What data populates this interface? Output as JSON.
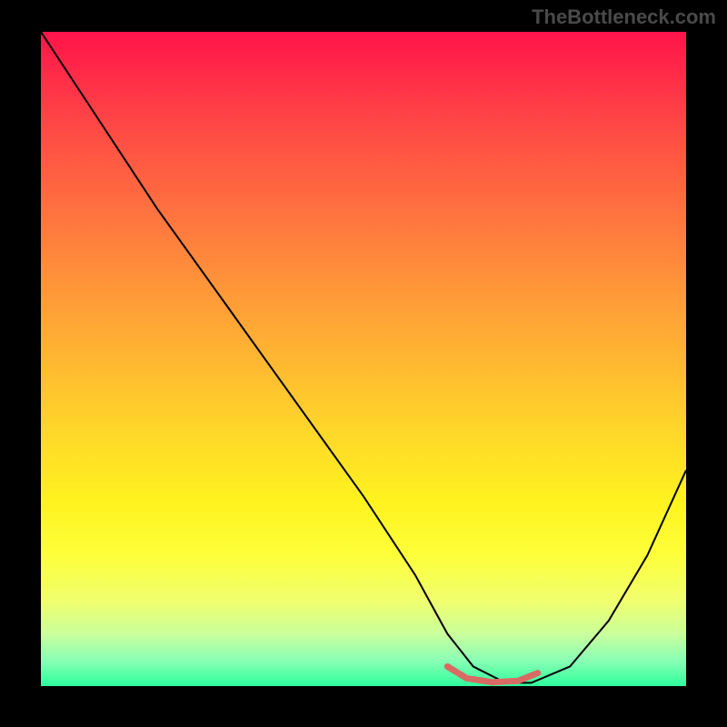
{
  "watermark": "TheBottleneck.com",
  "chart_data": {
    "type": "line",
    "title": "",
    "xlabel": "",
    "ylabel": "",
    "xlim": [
      0,
      100
    ],
    "ylim": [
      0,
      100
    ],
    "series": [
      {
        "name": "curve",
        "x": [
          0,
          4,
          10,
          18,
          26,
          34,
          42,
          50,
          58,
          63,
          67,
          72,
          76,
          82,
          88,
          94,
          100
        ],
        "values": [
          100,
          94,
          85,
          73,
          62,
          51,
          40,
          29,
          17,
          8,
          3,
          0.5,
          0.5,
          3,
          10,
          20,
          33
        ],
        "color": "#000000"
      },
      {
        "name": "highlight",
        "x": [
          63,
          66,
          70,
          74,
          77
        ],
        "values": [
          3,
          1.2,
          0.6,
          0.8,
          2
        ],
        "color": "#d96a64"
      }
    ]
  }
}
